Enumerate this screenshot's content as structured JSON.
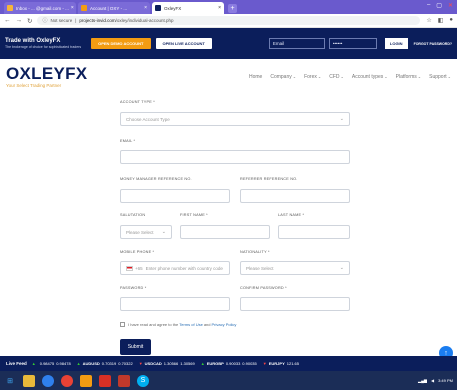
{
  "browser": {
    "tabs": [
      {
        "label": "Inbox - ... @gmail.com - ..."
      },
      {
        "label": "Account | OXY - ..."
      },
      {
        "label": "OxleyFX"
      }
    ],
    "url_secure": "Not secure",
    "url_domain": "projects-invid.com",
    "url_path": "/oxley/individual-account.php"
  },
  "topbar": {
    "brand_title": "Trade with OxleyFX",
    "brand_sub": "The brokerage of choice for sophisticated traders",
    "demo_label": "OPEN DEMO ACCOUNT",
    "live_label": "OPEN LIVE ACCOUNT",
    "email_placeholder": "Email",
    "password_placeholder": "••••••",
    "login_label": "LOGIN",
    "forgot_label": "FORGOT PASSWORD?"
  },
  "header": {
    "logo_main": "OXLEY",
    "logo_fx": "FX",
    "tagline": "Your Select Trading Partner",
    "nav": [
      {
        "label": "Home",
        "dropdown": false
      },
      {
        "label": "Company",
        "dropdown": true
      },
      {
        "label": "Forex",
        "dropdown": true
      },
      {
        "label": "CFD",
        "dropdown": true
      },
      {
        "label": "Account types",
        "dropdown": true
      },
      {
        "label": "Platforms",
        "dropdown": true
      },
      {
        "label": "Support",
        "dropdown": true
      }
    ]
  },
  "form": {
    "account_type_label": "ACCOUNT TYPE *",
    "account_type_value": "Choose Account Type",
    "email_label": "EMAIL *",
    "money_manager_label": "MONEY MANAGER REFERENCE NO.",
    "referrer_label": "REFERRER REFERENCE NO.",
    "salutation_label": "SALUTATION",
    "salutation_value": "Please Select",
    "first_name_label": "FIRST NAME *",
    "last_name_label": "LAST NAME *",
    "mobile_label": "MOBILE PHONE *",
    "mobile_code": "+65",
    "mobile_placeholder": "Enter phone number with country code",
    "nationality_label": "NATIONALITY *",
    "nationality_value": "Please Select",
    "password_label": "PASSWORD *",
    "confirm_password_label": "CONFIRM PASSWORD *",
    "terms_prefix": "I have read and agree to the",
    "terms_link": "Terms of Use",
    "terms_and": "and",
    "privacy_link": "Privacy Policy",
    "submit_label": "Submit"
  },
  "ticker": {
    "label": "Live Feed",
    "items": [
      {
        "sym": "",
        "v1": "0.98475",
        "v2": "0.98478",
        "dir": "up"
      },
      {
        "sym": "AUDUSD",
        "v1": "0.70319",
        "v2": "0.70322",
        "dir": "up"
      },
      {
        "sym": "USDCAD",
        "v1": "1.30566",
        "v2": "1.30569",
        "dir": "dn"
      },
      {
        "sym": "EURGBP",
        "v1": "0.90033",
        "v2": "0.90035",
        "dir": "up"
      },
      {
        "sym": "EURJPY",
        "v1": "121.65",
        "v2": "",
        "dir": "dn"
      }
    ]
  },
  "taskbar": {
    "time": "3:49 PM"
  }
}
